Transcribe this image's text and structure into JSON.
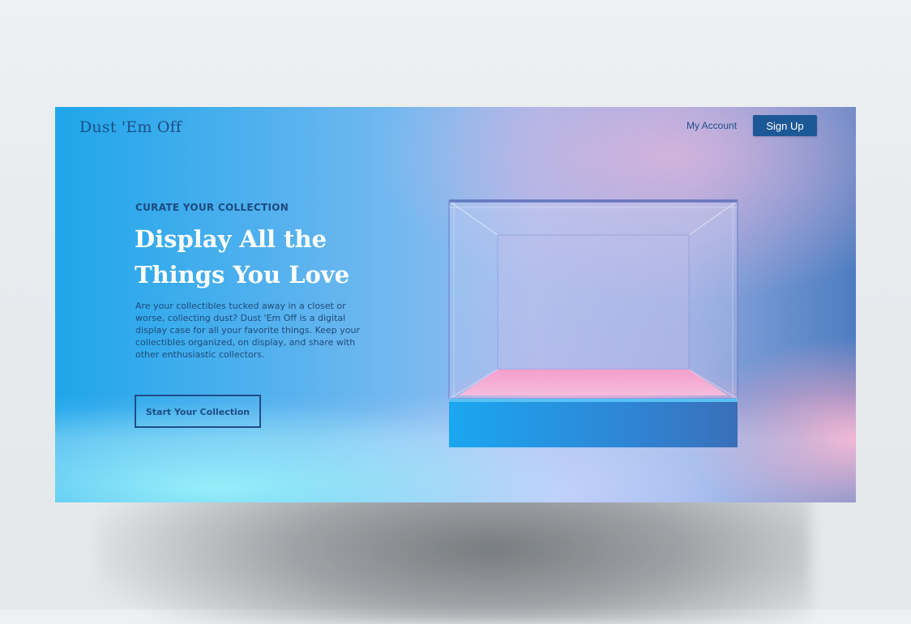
{
  "header": {
    "logo": "Dust 'Em Off",
    "my_account": "My Account",
    "sign_up": "Sign Up"
  },
  "hero": {
    "eyebrow": "CURATE YOUR COLLECTION",
    "headline_line1": "Display All the",
    "headline_line2": "Things You Love",
    "body": "Are your collectibles tucked away in a closet or worse, collecting dust? Dust 'Em Off is a digital display case for all your favorite things. Keep your collectibles organized, on display, and share with other enthusiastic collectors.",
    "cta": "Start Your Collection"
  },
  "colors": {
    "brand": "#1d5896",
    "text_dark": "#1f4a7a",
    "headline": "#ffffff",
    "hero_left": "#1fa6ea",
    "hero_pink": "#ffaac8"
  }
}
